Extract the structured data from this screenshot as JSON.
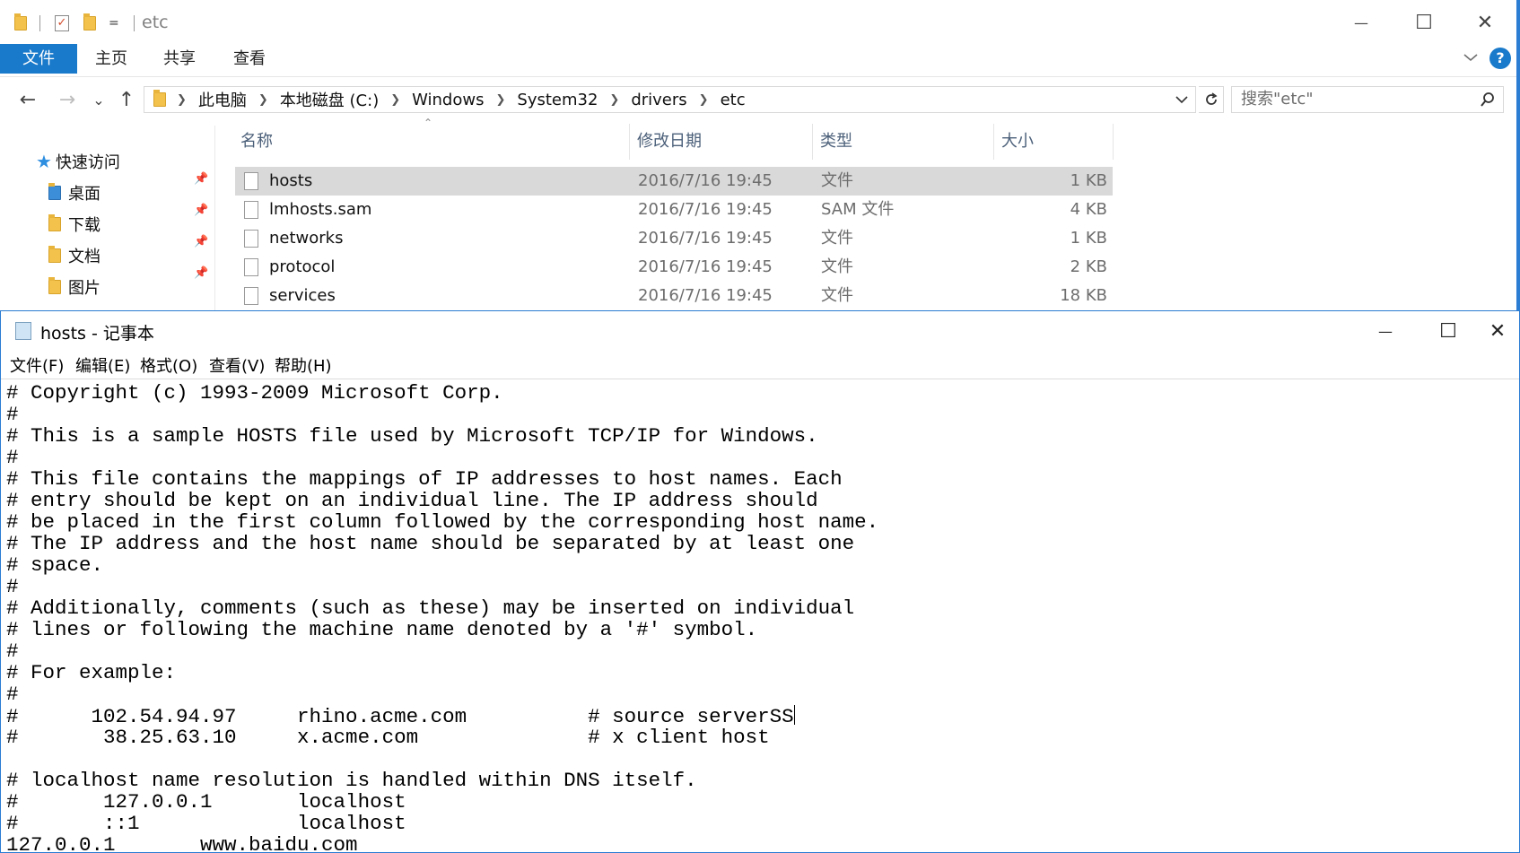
{
  "explorer": {
    "title": "etc",
    "quick_access_dropdown": "=",
    "window_controls": {
      "minimize": "—",
      "maximize": "☐",
      "close": "✕"
    },
    "ribbon_tabs": [
      "文件",
      "主页",
      "共享",
      "查看"
    ],
    "help_icon_label": "?",
    "ribbon_collapse_icon": "chevron-down-icon",
    "nav": {
      "back": "←",
      "forward": "→",
      "recent": "⌄",
      "up": "↑"
    },
    "address_crumbs": [
      "此电脑",
      "本地磁盘 (C:)",
      "Windows",
      "System32",
      "drivers",
      "etc"
    ],
    "search_placeholder": "搜索\"etc\"",
    "nav_pane": {
      "quick_access": "快速访问",
      "items": [
        {
          "label": "桌面",
          "icon": "desktop-folder-icon",
          "pinned": true
        },
        {
          "label": "下载",
          "icon": "downloads-folder-icon",
          "pinned": true
        },
        {
          "label": "文档",
          "icon": "documents-folder-icon",
          "pinned": true
        },
        {
          "label": "图片",
          "icon": "pictures-folder-icon",
          "pinned": true
        }
      ]
    },
    "columns": [
      "名称",
      "修改日期",
      "类型",
      "大小"
    ],
    "files": [
      {
        "name": "hosts",
        "date": "2016/7/16 19:45",
        "type": "文件",
        "size": "1 KB",
        "selected": true
      },
      {
        "name": "lmhosts.sam",
        "date": "2016/7/16 19:45",
        "type": "SAM 文件",
        "size": "4 KB",
        "selected": false
      },
      {
        "name": "networks",
        "date": "2016/7/16 19:45",
        "type": "文件",
        "size": "1 KB",
        "selected": false
      },
      {
        "name": "protocol",
        "date": "2016/7/16 19:45",
        "type": "文件",
        "size": "2 KB",
        "selected": false
      },
      {
        "name": "services",
        "date": "2016/7/16 19:45",
        "type": "文件",
        "size": "18 KB",
        "selected": false
      }
    ]
  },
  "notepad": {
    "title": "hosts - 记事本",
    "window_controls": {
      "minimize": "—",
      "maximize": "☐",
      "close": "✕"
    },
    "menu": [
      "文件(F)",
      "编辑(E)",
      "格式(O)",
      "查看(V)",
      "帮助(H)"
    ],
    "lines": [
      "# Copyright (c) 1993-2009 Microsoft Corp.",
      "#",
      "# This is a sample HOSTS file used by Microsoft TCP/IP for Windows.",
      "#",
      "# This file contains the mappings of IP addresses to host names. Each",
      "# entry should be kept on an individual line. The IP address should",
      "# be placed in the first column followed by the corresponding host name.",
      "# The IP address and the host name should be separated by at least one",
      "# space.",
      "#",
      "# Additionally, comments (such as these) may be inserted on individual",
      "# lines or following the machine name denoted by a '#' symbol.",
      "#",
      "# For example:",
      "#",
      "#      102.54.94.97     rhino.acme.com          # source serverSS",
      "#       38.25.63.10     x.acme.com              # x client host",
      "",
      "# localhost name resolution is handled within DNS itself.",
      "#       127.0.0.1       localhost",
      "#       ::1             localhost",
      "127.0.0.1       www.baidu.com"
    ],
    "caret_line": 15
  }
}
